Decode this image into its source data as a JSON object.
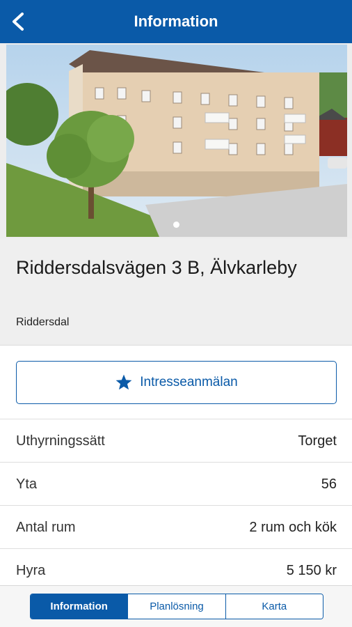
{
  "appbar": {
    "title": "Information",
    "back_icon": "chevron-left-icon"
  },
  "property": {
    "address": "Riddersdalsvägen 3 B, Älvkarleby",
    "area": "Riddersdal",
    "photo_count": 1,
    "active_photo": 1
  },
  "interest_button": {
    "label": "Intresseanmälan",
    "icon": "star-icon"
  },
  "details": [
    {
      "key": "Uthyrningssätt",
      "value": "Torget"
    },
    {
      "key": "Yta",
      "value": "56"
    },
    {
      "key": "Antal rum",
      "value": "2 rum och kök"
    },
    {
      "key": "Hyra",
      "value": "5 150 kr"
    }
  ],
  "tabs": [
    {
      "label": "Information",
      "active": true
    },
    {
      "label": "Planlösning",
      "active": false
    },
    {
      "label": "Karta",
      "active": false
    }
  ],
  "colors": {
    "brand": "#0a5aa8",
    "header_bg": "#efefef"
  }
}
